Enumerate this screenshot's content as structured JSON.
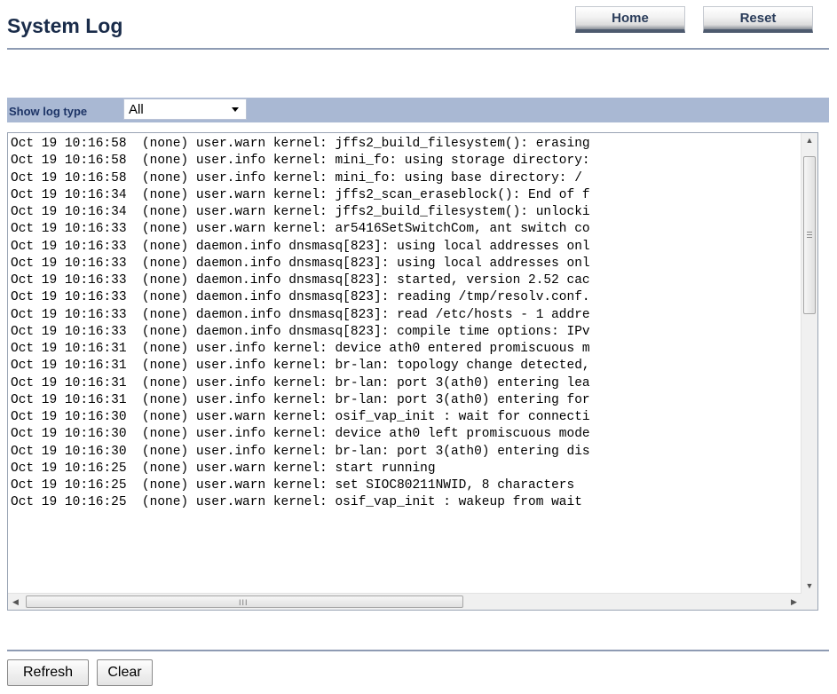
{
  "page_title": "System Log",
  "header_buttons": {
    "home": "Home",
    "reset": "Reset"
  },
  "log_type": {
    "label": "Show log type",
    "selected": "All"
  },
  "log_lines": [
    "Oct 19 10:16:58  (none) user.warn kernel: jffs2_build_filesystem(): erasing",
    "Oct 19 10:16:58  (none) user.info kernel: mini_fo: using storage directory:",
    "Oct 19 10:16:58  (none) user.info kernel: mini_fo: using base directory: /",
    "Oct 19 10:16:34  (none) user.warn kernel: jffs2_scan_eraseblock(): End of f",
    "Oct 19 10:16:34  (none) user.warn kernel: jffs2_build_filesystem(): unlocki",
    "Oct 19 10:16:33  (none) user.warn kernel: ar5416SetSwitchCom, ant switch co",
    "Oct 19 10:16:33  (none) daemon.info dnsmasq[823]: using local addresses onl",
    "Oct 19 10:16:33  (none) daemon.info dnsmasq[823]: using local addresses onl",
    "Oct 19 10:16:33  (none) daemon.info dnsmasq[823]: started, version 2.52 cac",
    "Oct 19 10:16:33  (none) daemon.info dnsmasq[823]: reading /tmp/resolv.conf.",
    "Oct 19 10:16:33  (none) daemon.info dnsmasq[823]: read /etc/hosts - 1 addre",
    "Oct 19 10:16:33  (none) daemon.info dnsmasq[823]: compile time options: IPv",
    "Oct 19 10:16:31  (none) user.info kernel: device ath0 entered promiscuous m",
    "Oct 19 10:16:31  (none) user.info kernel: br-lan: topology change detected,",
    "Oct 19 10:16:31  (none) user.info kernel: br-lan: port 3(ath0) entering lea",
    "Oct 19 10:16:31  (none) user.info kernel: br-lan: port 3(ath0) entering for",
    "Oct 19 10:16:30  (none) user.warn kernel: osif_vap_init : wait for connecti",
    "Oct 19 10:16:30  (none) user.info kernel: device ath0 left promiscuous mode",
    "Oct 19 10:16:30  (none) user.info kernel: br-lan: port 3(ath0) entering dis",
    "Oct 19 10:16:25  (none) user.warn kernel: start running",
    "Oct 19 10:16:25  (none) user.warn kernel: set SIOC80211NWID, 8 characters",
    "Oct 19 10:16:25  (none) user.warn kernel: osif_vap_init : wakeup from wait"
  ],
  "scrollbar": {
    "horizontal_grip": "III"
  },
  "footer_buttons": {
    "refresh": "Refresh",
    "clear": "Clear"
  }
}
